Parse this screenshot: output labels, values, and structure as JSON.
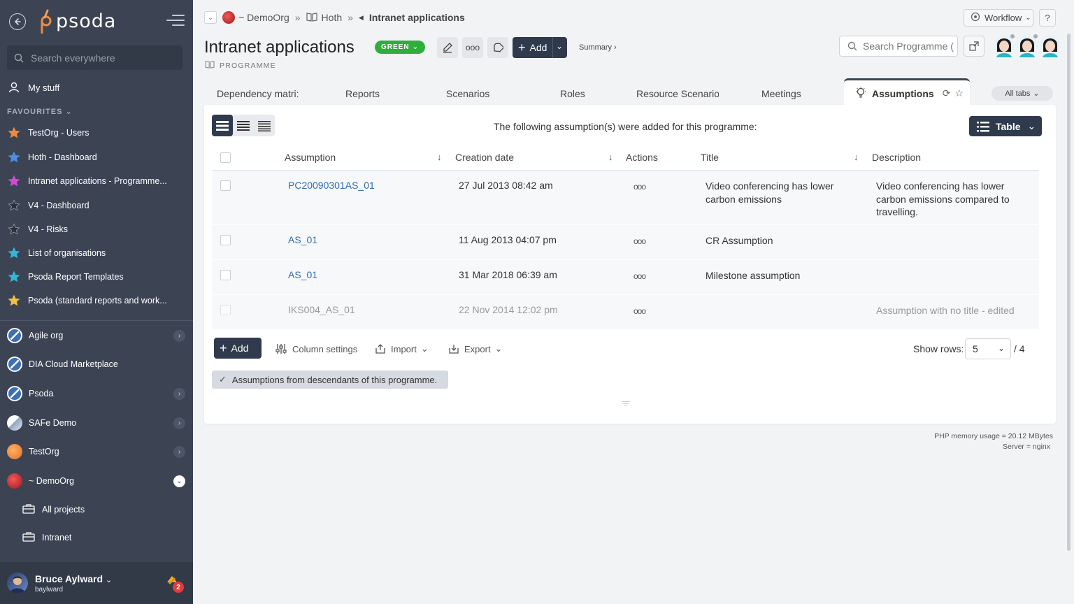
{
  "sidebar": {
    "logo": "psoda",
    "search_placeholder": "Search everywhere",
    "my_stuff": "My stuff",
    "favourites_heading": "FAVOURITES",
    "favourites": [
      {
        "label": "TestOrg - Users",
        "color": "#f08a3c"
      },
      {
        "label": "Hoth - Dashboard",
        "color": "#4a90e2"
      },
      {
        "label": "Intranet applications - Programme...",
        "color": "#d24ad2"
      },
      {
        "label": "V4 - Dashboard",
        "color": "#2b2f38"
      },
      {
        "label": "V4 - Risks",
        "color": "#2b2f38"
      },
      {
        "label": "List of organisations",
        "color": "#34b6d6"
      },
      {
        "label": "Psoda Report Templates",
        "color": "#34b6d6"
      },
      {
        "label": "Psoda (standard reports and work...",
        "color": "#f0c040"
      }
    ],
    "orgs": [
      {
        "label": "Agile org",
        "expandable": true
      },
      {
        "label": "DIA Cloud Marketplace",
        "expandable": false
      },
      {
        "label": "Psoda",
        "expandable": true
      },
      {
        "label": "SAFe Demo",
        "expandable": true
      },
      {
        "label": "TestOrg",
        "expandable": true
      },
      {
        "label": "~ DemoOrg",
        "expandable": true
      }
    ],
    "sub_items": [
      "All projects",
      "Intranet"
    ],
    "user": {
      "name": "Bruce Aylward",
      "login": "baylward",
      "notifications": "2"
    }
  },
  "breadcrumb": {
    "org": "~ DemoOrg",
    "portfolio": "Hoth",
    "current": "Intranet applications"
  },
  "header": {
    "title": "Intranet applications",
    "status": "GREEN",
    "type": "PROGRAMME",
    "add_label": "Add",
    "summary_label": "Summary ›",
    "search_placeholder": "Search Programme (",
    "workflow_label": "Workflow",
    "help_label": "?"
  },
  "tabs": {
    "items": [
      "Dependency matri:",
      "Reports",
      "Scenarios",
      "Roles",
      "Resource Scenario:",
      "Meetings"
    ],
    "active": "Assumptions",
    "all_tabs_label": "All tabs"
  },
  "content": {
    "notice": "The following assumption(s) were added for this programme:",
    "view_mode_label": "Table",
    "columns": [
      "Assumption",
      "Creation date",
      "Actions",
      "Title",
      "Description"
    ],
    "rows": [
      {
        "id": "PC20090301AS_01",
        "date": "27 Jul 2013 08:42 am",
        "title": "Video conferencing has lower carbon emissions",
        "description": "Video conferencing has lower carbon emissions compared to travelling.",
        "muted": false
      },
      {
        "id": "AS_01",
        "date": "11 Aug 2013 04:07 pm",
        "title": "CR Assumption",
        "description": "",
        "muted": false
      },
      {
        "id": "AS_01",
        "date": "31 Mar 2018 06:39 am",
        "title": "Milestone assumption",
        "description": "",
        "muted": false
      },
      {
        "id": "IKS004_AS_01",
        "date": "22 Nov 2014 12:02 pm",
        "title": "",
        "description": "Assumption with no title - edited",
        "muted": true
      }
    ],
    "footer": {
      "add_label": "Add",
      "column_settings": "Column settings",
      "import_label": "Import",
      "export_label": "Export",
      "show_rows_label": "Show rows:",
      "rows_value": "5",
      "total": "/ 4"
    },
    "descendants_label": "Assumptions from descendants of this programme."
  },
  "server_info": {
    "memory": "PHP memory usage = 20.12 MBytes",
    "server": "Server = nginx"
  }
}
